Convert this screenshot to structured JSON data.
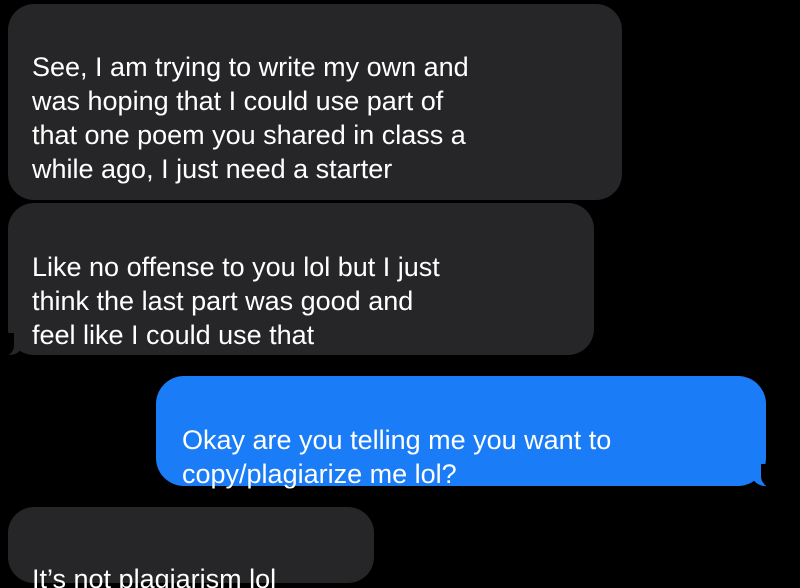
{
  "messages": [
    {
      "direction": "incoming",
      "text": "See, I am trying to write my own and\nwas hoping that I could use part of\nthat one poem you shared in class a\nwhile ago, I just need a starter"
    },
    {
      "direction": "incoming",
      "text": "Like no offense to you lol but I just\nthink the last part was good and\nfeel like I could use that"
    },
    {
      "direction": "outgoing",
      "text": "Okay are you telling me you want to\ncopy/plagiarize me lol?"
    },
    {
      "direction": "incoming",
      "text": "It’s not plagiarism lol"
    }
  ],
  "colors": {
    "background": "#000000",
    "incoming_bubble": "#262628",
    "outgoing_bubble": "#1a7cf6",
    "text": "#ffffff"
  }
}
